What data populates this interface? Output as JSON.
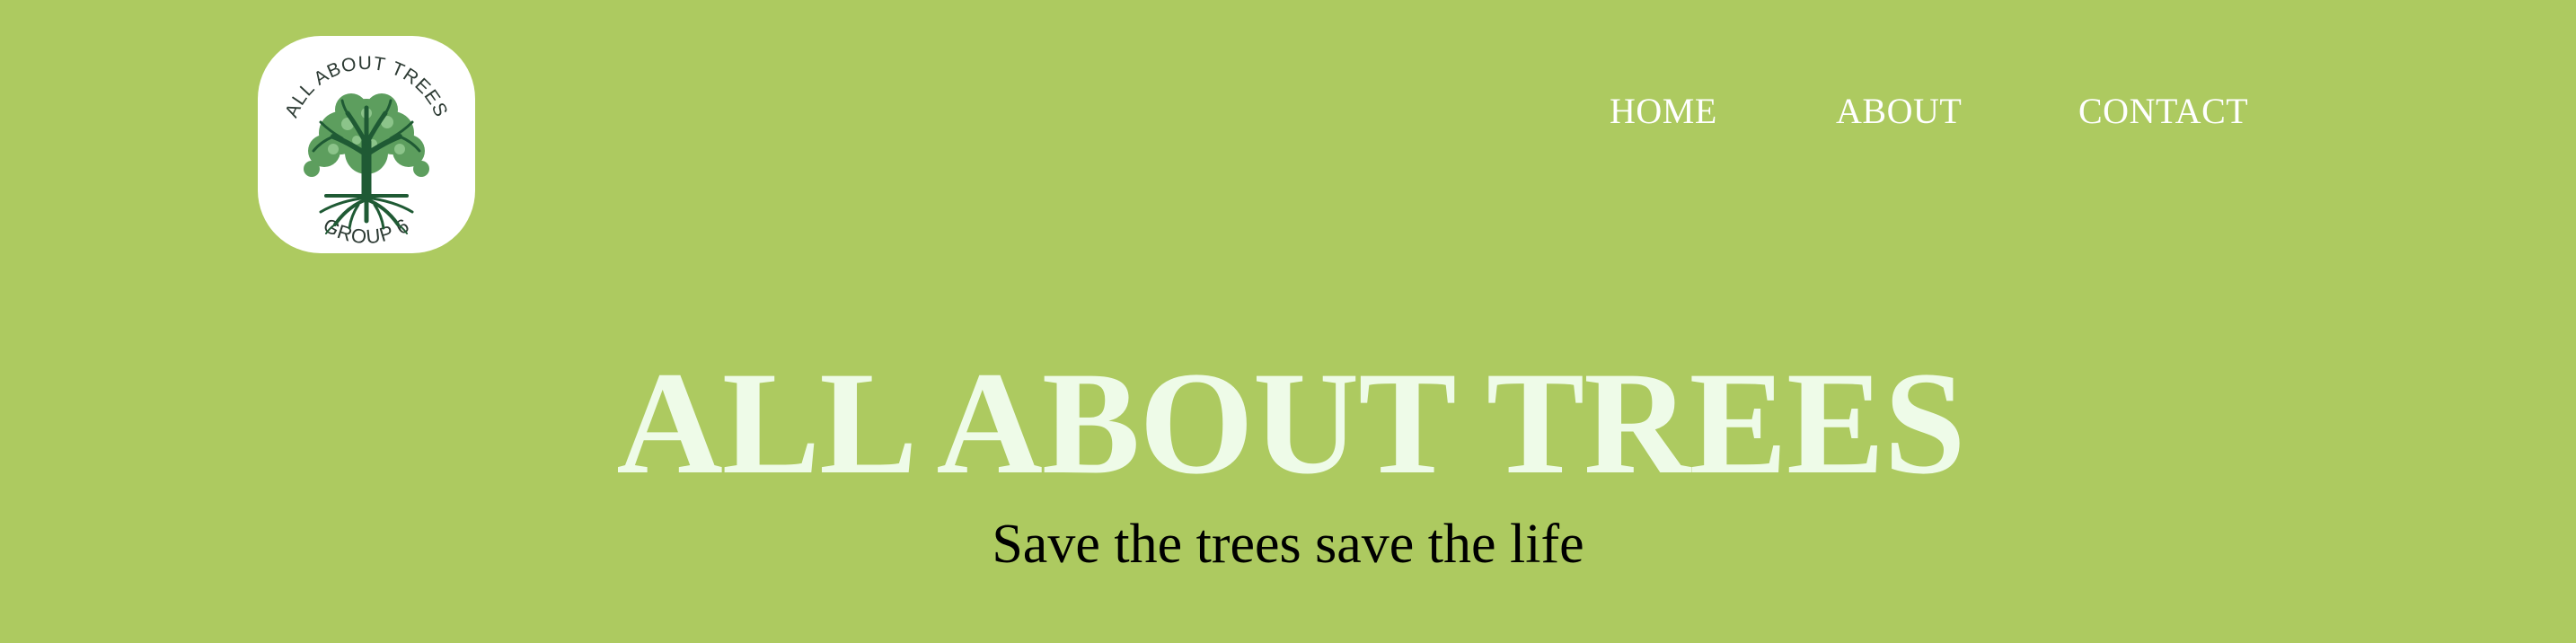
{
  "logo": {
    "top_text": "ALL ABOUT TREES",
    "bottom_text": "GROUP 6",
    "icon": "tree-icon"
  },
  "nav": {
    "items": [
      {
        "label": "HOME"
      },
      {
        "label": "ABOUT"
      },
      {
        "label": "CONTACT"
      }
    ]
  },
  "hero": {
    "title": "ALL ABOUT TREES",
    "tagline": "Save the trees save the life"
  },
  "colors": {
    "background": "#adca60",
    "nav_text": "#ffffff",
    "hero_title": "#eefbe8",
    "tagline": "#000000",
    "logo_bg": "#ffffff",
    "tree_trunk": "#1f5a34",
    "tree_leaves": "#5d9e5e"
  }
}
